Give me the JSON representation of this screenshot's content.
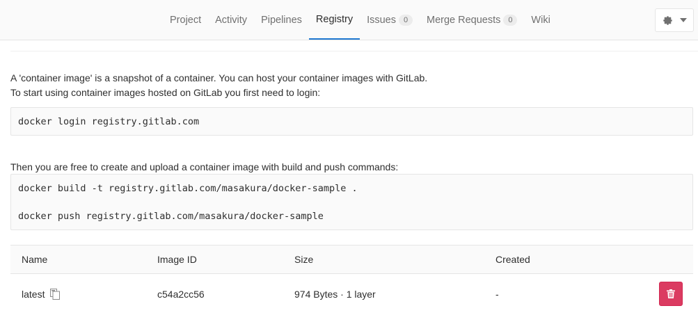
{
  "nav": {
    "tabs": [
      {
        "label": "Project"
      },
      {
        "label": "Activity"
      },
      {
        "label": "Pipelines"
      },
      {
        "label": "Registry",
        "active": true
      },
      {
        "label": "Issues",
        "count": "0"
      },
      {
        "label": "Merge Requests",
        "count": "0"
      },
      {
        "label": "Wiki"
      }
    ],
    "settings_icon": "gear-icon",
    "settings_caret_icon": "caret-down-icon",
    "active_color": "#1f78d1"
  },
  "intro": {
    "line1": "A 'container image' is a snapshot of a container. You can host your container images with GitLab.",
    "line2": "To start using container images hosted on GitLab you first need to login:"
  },
  "login_code": "docker login registry.gitlab.com",
  "build_intro": "Then you are free to create and upload a container image with build and push commands:",
  "build_code": {
    "build": "docker build -t registry.gitlab.com/masakura/docker-sample .",
    "push": "docker push registry.gitlab.com/masakura/docker-sample"
  },
  "table": {
    "headers": {
      "name": "Name",
      "image_id": "Image ID",
      "size": "Size",
      "created": "Created"
    },
    "rows": [
      {
        "name": "latest",
        "image_id": "c54a2cc56",
        "size": "974 Bytes · 1 layer",
        "created": "-",
        "copy_icon": "clipboard-icon",
        "delete_icon": "trash-icon"
      }
    ]
  },
  "colors": {
    "danger": "#db3b61"
  }
}
